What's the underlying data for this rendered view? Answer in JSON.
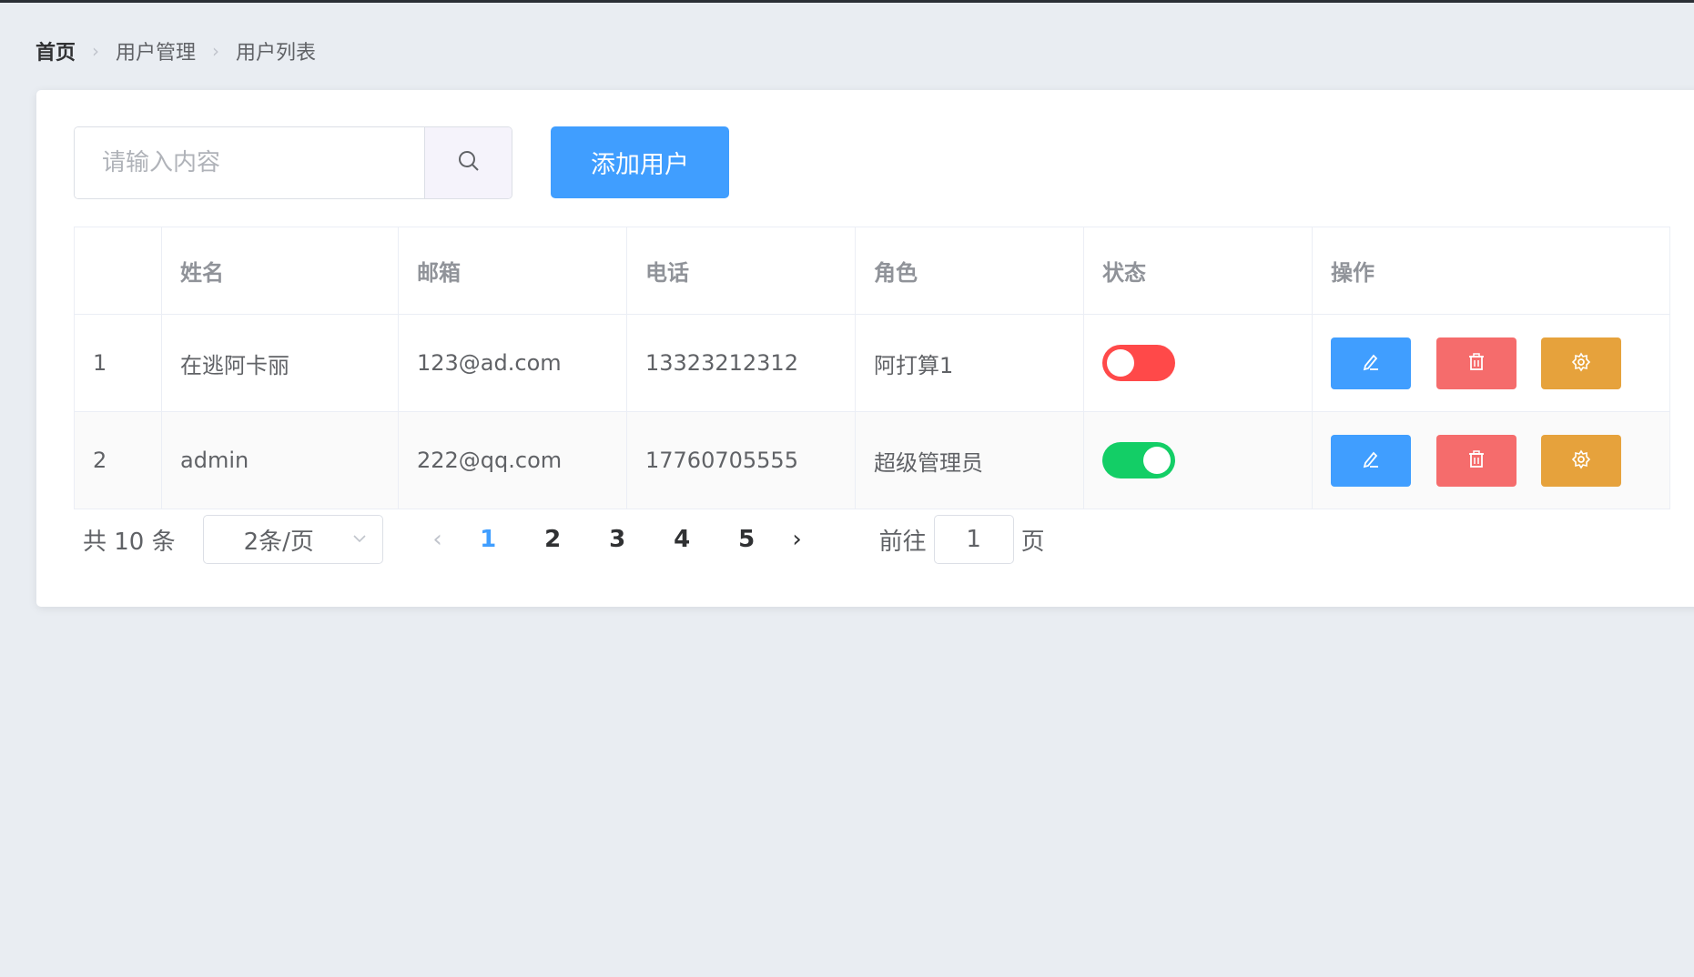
{
  "breadcrumb": {
    "items": [
      "首页",
      "用户管理",
      "用户列表"
    ]
  },
  "search": {
    "placeholder": "请输入内容",
    "value": ""
  },
  "toolbar": {
    "add_label": "添加用户"
  },
  "table": {
    "headers": [
      "",
      "姓名",
      "邮箱",
      "电话",
      "角色",
      "状态",
      "操作"
    ],
    "rows": [
      {
        "index": "1",
        "name": "在逃阿卡丽",
        "email": "123@ad.com",
        "phone": "13323212312",
        "role": "阿打算1",
        "status": false
      },
      {
        "index": "2",
        "name": "admin",
        "email": "222@qq.com",
        "phone": "17760705555",
        "role": "超级管理员",
        "status": true
      }
    ]
  },
  "pagination": {
    "total_text": "共 10 条",
    "page_size": "2条/页",
    "pages": [
      "1",
      "2",
      "3",
      "4",
      "5"
    ],
    "current_page": "1",
    "goto_label": "前往",
    "goto_value": "1",
    "goto_suffix": "页"
  },
  "colors": {
    "primary": "#409eff",
    "danger": "#f56c6c",
    "warning": "#e6a23c",
    "switch_on": "#13ce66",
    "switch_off": "#ff4949"
  },
  "icons": {
    "search": "search-icon",
    "edit": "edit-icon",
    "delete": "delete-icon",
    "settings": "setting-icon"
  }
}
